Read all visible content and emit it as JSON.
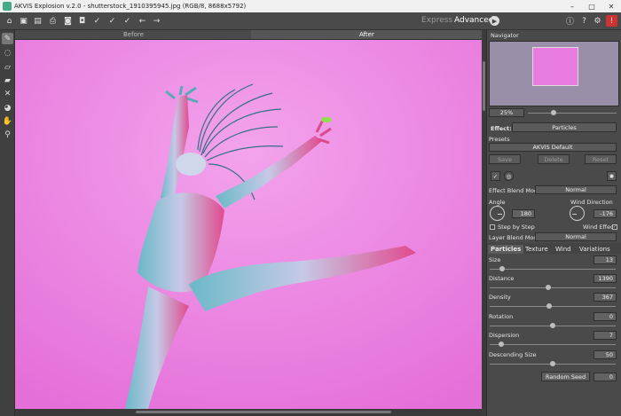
{
  "window": {
    "title": "AKVIS Explosion v.2.0 - shutterstock_1910395945.jpg (RGB/8, 8688x5792)",
    "controls": [
      "–",
      "□",
      "✕"
    ]
  },
  "toolbar": {
    "mode_express": "Express",
    "mode_advanced": "Advanced"
  },
  "canvas_tabs": {
    "before": "Before",
    "after": "After"
  },
  "navigator": {
    "title": "Navigator",
    "zoom": "25%"
  },
  "effect": {
    "label": "Effect:",
    "value": "Particles"
  },
  "presets": {
    "label": "Presets",
    "value": "AKVIS Default",
    "save": "Save",
    "delete": "Delete",
    "reset": "Reset"
  },
  "effect_blend": {
    "label": "Effect Blend Mode",
    "value": "Normal"
  },
  "angle": {
    "label": "Angle",
    "value": "180"
  },
  "wind_direction": {
    "label": "Wind Direction",
    "value": "-176"
  },
  "step_by_step": {
    "label": "Step by Step",
    "checked": false
  },
  "wind_effect": {
    "label": "Wind Effect",
    "checked": true
  },
  "layer_blend": {
    "label": "Layer Blend Mode",
    "value": "Normal"
  },
  "param_tabs": [
    "Particles",
    "Texture",
    "Wind",
    "Variations"
  ],
  "params": [
    {
      "label": "Size",
      "value": "13",
      "level": 0.08
    },
    {
      "label": "Distance",
      "value": "1390",
      "level": 0.46
    },
    {
      "label": "Density",
      "value": "367",
      "level": 0.47
    },
    {
      "label": "Rotation",
      "value": "0",
      "level": 0.5
    },
    {
      "label": "Dispersion",
      "value": "7",
      "level": 0.07
    },
    {
      "label": "Descending Size",
      "value": "50",
      "level": 0.5
    }
  ],
  "random_seed": {
    "label": "Random Seed",
    "value": "0"
  },
  "colors": {
    "background": "#ea7ae0",
    "accent_green": "#8ee04a"
  }
}
